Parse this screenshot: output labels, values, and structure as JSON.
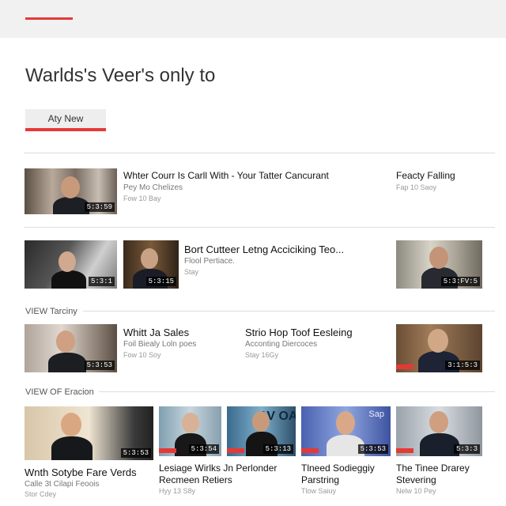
{
  "header": {
    "accent_color": "#e53935"
  },
  "page": {
    "title": "Warlds's Veer's only to"
  },
  "filter": {
    "label": "Aty New"
  },
  "row1": {
    "video1": {
      "title": "Whter Courr Is Carll With - Your Tatter Cancurant",
      "channel": "Pey Mo Chelizes",
      "age": "Fow 10 Bay",
      "duration": "5:3:59"
    },
    "side": {
      "title": "Feacty Falling",
      "meta": "Fap 10 Saoy"
    }
  },
  "row2": {
    "thumb1": {
      "duration": "5:3:1"
    },
    "thumb2": {
      "duration": "5:3:15"
    },
    "video": {
      "title": "Bort Cutteer Letng Acciciking Teo...",
      "channel": "Flool Pertiace.",
      "age": "Stay"
    },
    "side": {
      "duration": "5:3:FV:5"
    }
  },
  "section1": {
    "label": "VIEW Tarciny",
    "video1": {
      "title": "Whitt Ja Sales",
      "channel": "Foil Biealy Loln poes",
      "age": "Fow 10 Soy",
      "duration": "5:3:53"
    },
    "video2": {
      "title": "Strio Hop Toof Eesleing",
      "channel": "Acconting Diercoces",
      "age": "Stay 16Gy"
    },
    "side": {
      "duration": "3:1:5:3"
    }
  },
  "section2": {
    "label": "VIEW OF Eracion",
    "video1": {
      "title": "Wnth Sotybe Fare Verds",
      "channel": "Calle 3t Cilapi Feoois",
      "age": "Stor Cdey",
      "duration": "5:3:53"
    },
    "video2": {
      "title": "Lesiage Wirlks Jn Perlonder",
      "subtitle": "Recmeen Retiers",
      "age": "Hyy 13 S8y",
      "duration": "5:3:54"
    },
    "video3": {
      "duration": "5:3:13",
      "thumb_text": "AV OA"
    },
    "video4": {
      "title": "Tlneed Sodieggiy",
      "subtitle": "Parstring",
      "age": "Tlow Saiuy",
      "duration": "5:3:53",
      "thumb_text": "Sap"
    },
    "video5": {
      "title": "The Tinee Drarey",
      "subtitle": "Stevering",
      "age": "Nelw 10 Pey",
      "duration": "5:3:3"
    }
  }
}
